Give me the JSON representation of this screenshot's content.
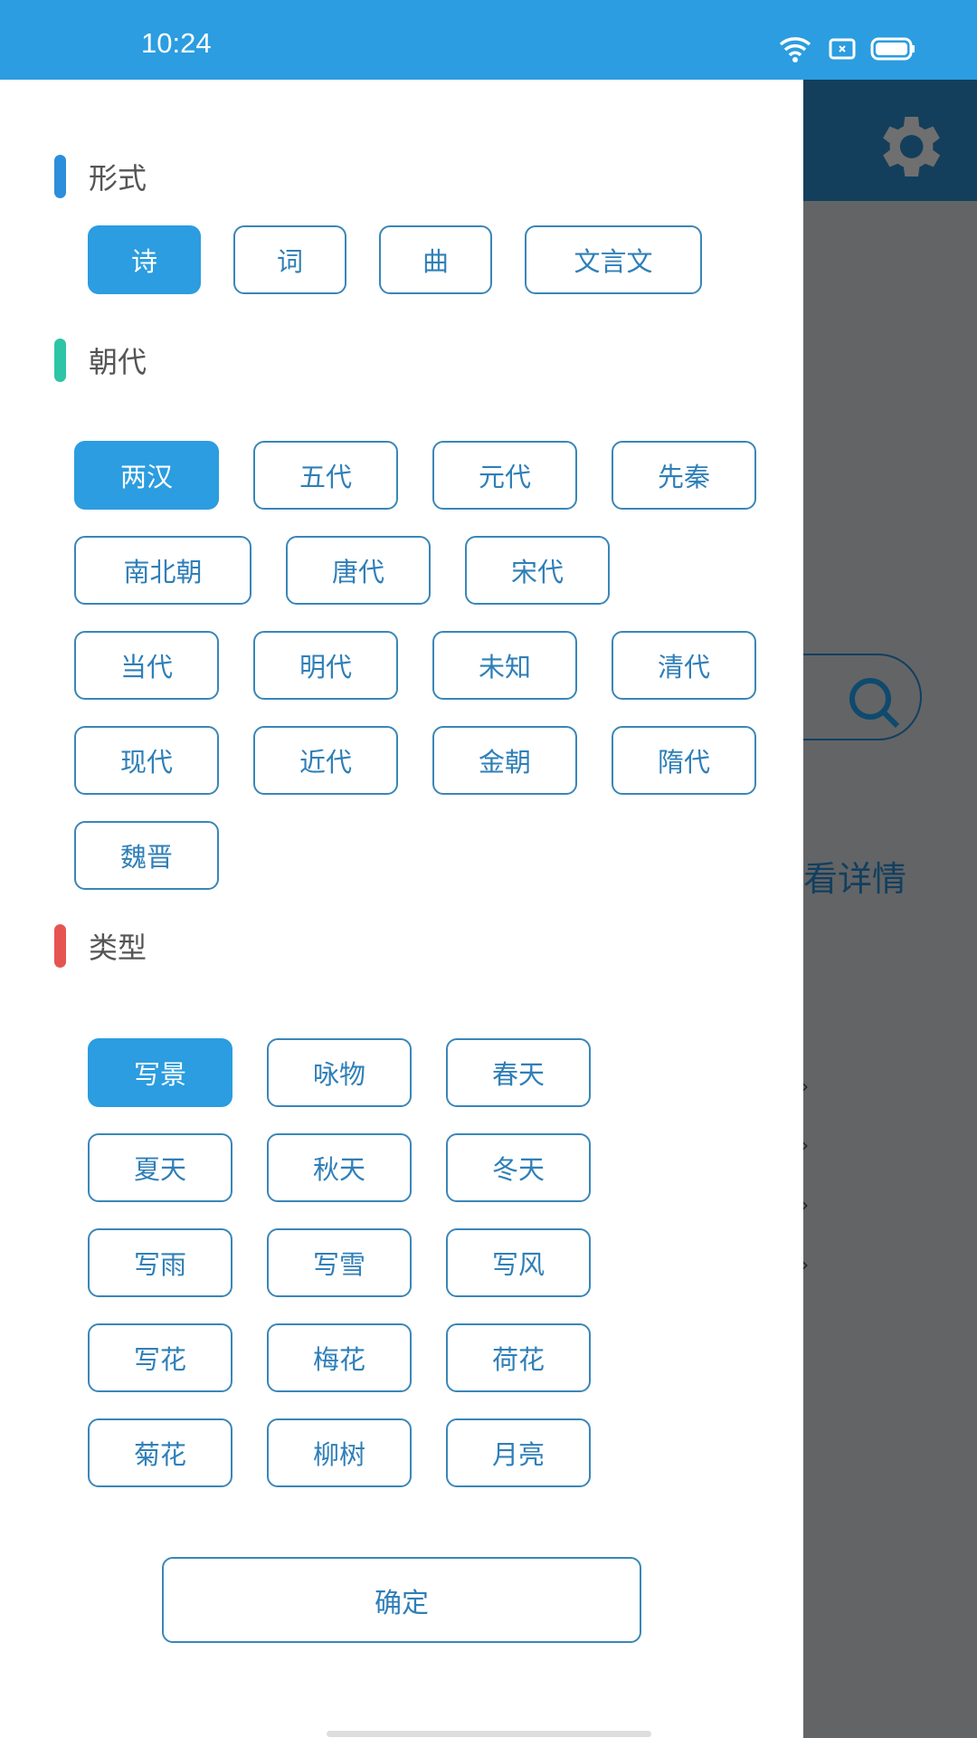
{
  "status_bar": {
    "time": "10:24",
    "icons": [
      "wifi-icon",
      "sim-icon",
      "battery-icon"
    ]
  },
  "background": {
    "detail_text": "看详情",
    "icons": [
      "gear-icon",
      "search-icon"
    ]
  },
  "drawer": {
    "sections": [
      {
        "title": "形式",
        "color": "#2b8fdc",
        "options": [
          "诗",
          "词",
          "曲",
          "文言文"
        ],
        "selected": "诗"
      },
      {
        "title": "朝代",
        "color": "#2ec4a6",
        "options": [
          "两汉",
          "五代",
          "元代",
          "先秦",
          "南北朝",
          "唐代",
          "宋代",
          "当代",
          "明代",
          "未知",
          "清代",
          "现代",
          "近代",
          "金朝",
          "隋代",
          "魏晋"
        ],
        "selected": "两汉"
      },
      {
        "title": "类型",
        "color": "#e65452",
        "options": [
          "写景",
          "咏物",
          "春天",
          "夏天",
          "秋天",
          "冬天",
          "写雨",
          "写雪",
          "写风",
          "写花",
          "梅花",
          "荷花",
          "菊花",
          "柳树",
          "月亮"
        ],
        "selected": "写景"
      }
    ],
    "confirm_label": "确定"
  },
  "colors": {
    "accent": "#2b9de0",
    "header_dark": "#133f5c",
    "overlay": "#636466"
  }
}
